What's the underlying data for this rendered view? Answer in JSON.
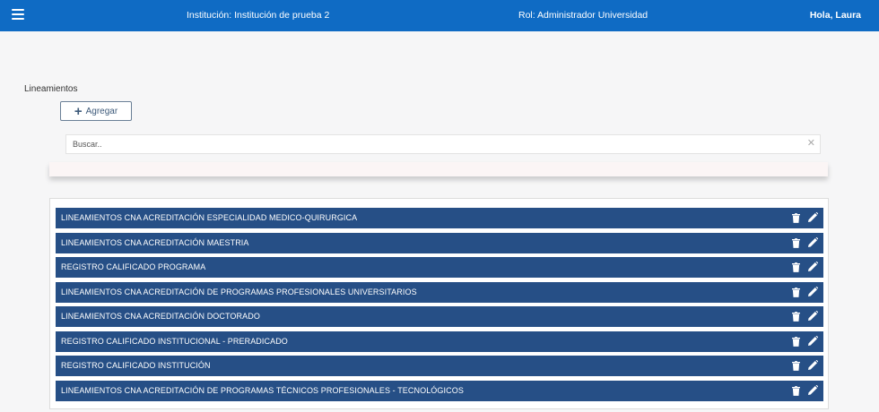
{
  "header": {
    "institution": "Institución: Institución de prueba 2",
    "role": "Rol: Administrador Universidad",
    "greeting": "Hola, Laura",
    "menu_icon": "hamburger-menu-icon",
    "background_color": "#0f6bc4"
  },
  "page": {
    "title": "Lineamientos"
  },
  "toolbar": {
    "add_label": "Agregar",
    "add_icon": "plus-icon"
  },
  "search": {
    "placeholder": "Buscar..",
    "value": "",
    "clear_icon": "close-icon"
  },
  "list": {
    "item_color": "#264f86",
    "items": [
      {
        "label": "LINEAMIENTOS CNA ACREDITACIÓN ESPECIALIDAD MEDICO-QUIRURGICA"
      },
      {
        "label": "LINEAMIENTOS CNA ACREDITACIÓN MAESTRIA"
      },
      {
        "label": "REGISTRO CALIFICADO PROGRAMA"
      },
      {
        "label": "LINEAMIENTOS CNA ACREDITACIÓN DE PROGRAMAS PROFESIONALES UNIVERSITARIOS"
      },
      {
        "label": "LINEAMIENTOS CNA ACREDITACIÓN DOCTORADO"
      },
      {
        "label": "REGISTRO CALIFICADO INSTITUCIONAL - PRERADICADO"
      },
      {
        "label": "REGISTRO CALIFICADO INSTITUCIÓN"
      },
      {
        "label": "LINEAMIENTOS CNA ACREDITACIÓN DE PROGRAMAS TÉCNICOS PROFESIONALES - TECNOLÓGICOS"
      }
    ],
    "row_actions": [
      "trash-icon",
      "pencil-icon"
    ]
  }
}
